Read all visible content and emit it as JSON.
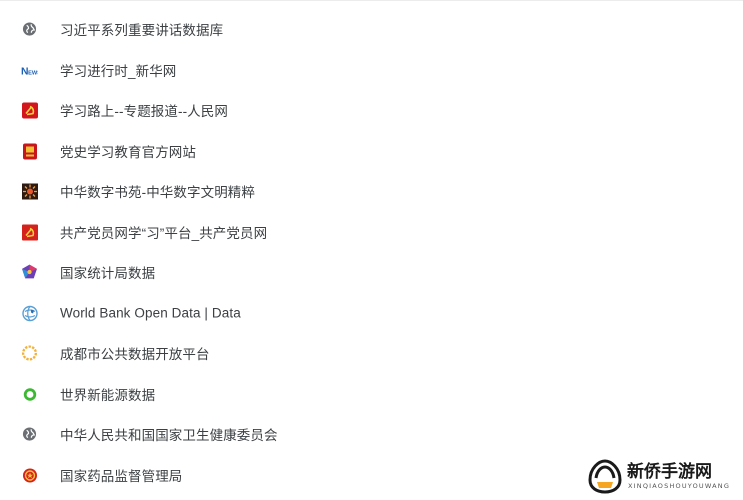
{
  "bookmarks": [
    {
      "label": "习近平系列重要讲话数据库",
      "icon": "globe-icon"
    },
    {
      "label": "学习进行时_新华网",
      "icon": "xinhua-news-icon"
    },
    {
      "label": "学习路上--专题报道--人民网",
      "icon": "party-emblem-icon"
    },
    {
      "label": "党史学习教育官方网站",
      "icon": "party-history-icon"
    },
    {
      "label": "中华数字书苑-中华数字文明精粹",
      "icon": "sunburst-icon"
    },
    {
      "label": "共产党员网学“习”平台_共产党员网",
      "icon": "party-member-icon"
    },
    {
      "label": "国家统计局数据",
      "icon": "stats-bureau-icon"
    },
    {
      "label": "World Bank Open Data | Data",
      "icon": "world-bank-icon"
    },
    {
      "label": "成都市公共数据开放平台",
      "icon": "chengdu-data-icon"
    },
    {
      "label": "世界新能源数据",
      "icon": "green-ring-icon"
    },
    {
      "label": "中华人民共和国国家卫生健康委员会",
      "icon": "globe-icon"
    },
    {
      "label": "国家药品监督管理局",
      "icon": "national-emblem-icon"
    }
  ],
  "watermark": {
    "title": "新侨手游网",
    "subtitle": "XINQIAOSHOUYOUWANG"
  }
}
